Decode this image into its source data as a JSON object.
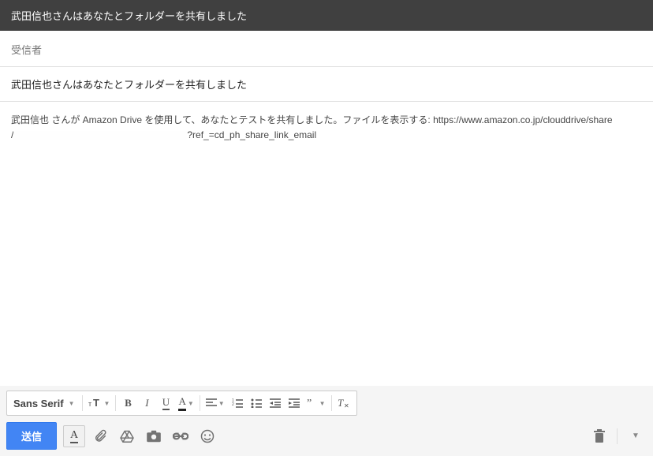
{
  "header": {
    "title": "武田信也さんはあなたとフォルダーを共有しました"
  },
  "recipient": {
    "label": "受信者"
  },
  "subject": {
    "value": "武田信也さんはあなたとフォルダーを共有しました"
  },
  "body": {
    "line1_prefix": "武田信也 さんが Amazon Drive を使用して、あなたとテストを共有しました。ファイルを表示する: ",
    "url_head": "https://www.amazon.co.jp/clouddrive/share",
    "line2_prefix": "/",
    "line2_suffix": "?ref_=cd_ph_share_link_email"
  },
  "format": {
    "font_name": "Sans Serif"
  },
  "actions": {
    "send": "送信"
  }
}
